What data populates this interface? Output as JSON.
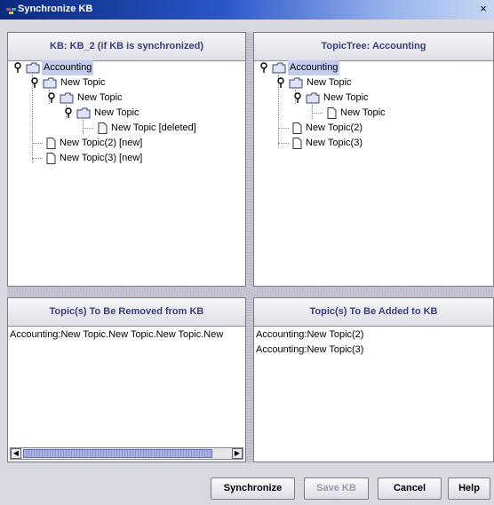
{
  "window": {
    "title": "Synchronize KB",
    "close_glyph": "×"
  },
  "panes": {
    "kb": {
      "header": "KB: KB_2 (if KB is synchronized)",
      "tree": [
        {
          "label": "Accounting",
          "selected": true
        },
        {
          "label": "New Topic"
        },
        {
          "label": "New Topic"
        },
        {
          "label": "New Topic"
        },
        {
          "label": "New Topic [deleted]"
        },
        {
          "label": "New Topic(2) [new]"
        },
        {
          "label": "New Topic(3) [new]"
        }
      ]
    },
    "topictree": {
      "header": "TopicTree: Accounting",
      "tree": [
        {
          "label": "Accounting",
          "selected": true
        },
        {
          "label": "New Topic"
        },
        {
          "label": "New Topic"
        },
        {
          "label": "New Topic"
        },
        {
          "label": "New Topic(2)"
        },
        {
          "label": "New Topic(3)"
        }
      ]
    },
    "removed": {
      "header": "Topic(s) To Be Removed from KB",
      "items": [
        "Accounting:New Topic.New Topic.New Topic.New"
      ]
    },
    "added": {
      "header": "Topic(s) To Be Added to KB",
      "items": [
        "Accounting:New Topic(2)",
        "Accounting:New Topic(3)"
      ]
    }
  },
  "buttons": {
    "synchronize": "Synchronize",
    "save_kb": "Save KB",
    "cancel": "Cancel",
    "help": "Help"
  },
  "icons": {
    "app": "app-icon",
    "folder": "folder-icon",
    "document": "document-icon",
    "expand_handle": "tree-handle-icon"
  },
  "colors": {
    "header_text": "#3a3f7a",
    "selection": "#c4ccec",
    "titlebar_start": "#0a2a7e",
    "titlebar_end": "#c7d6f2",
    "disabled_text": "#9a9aa6"
  }
}
